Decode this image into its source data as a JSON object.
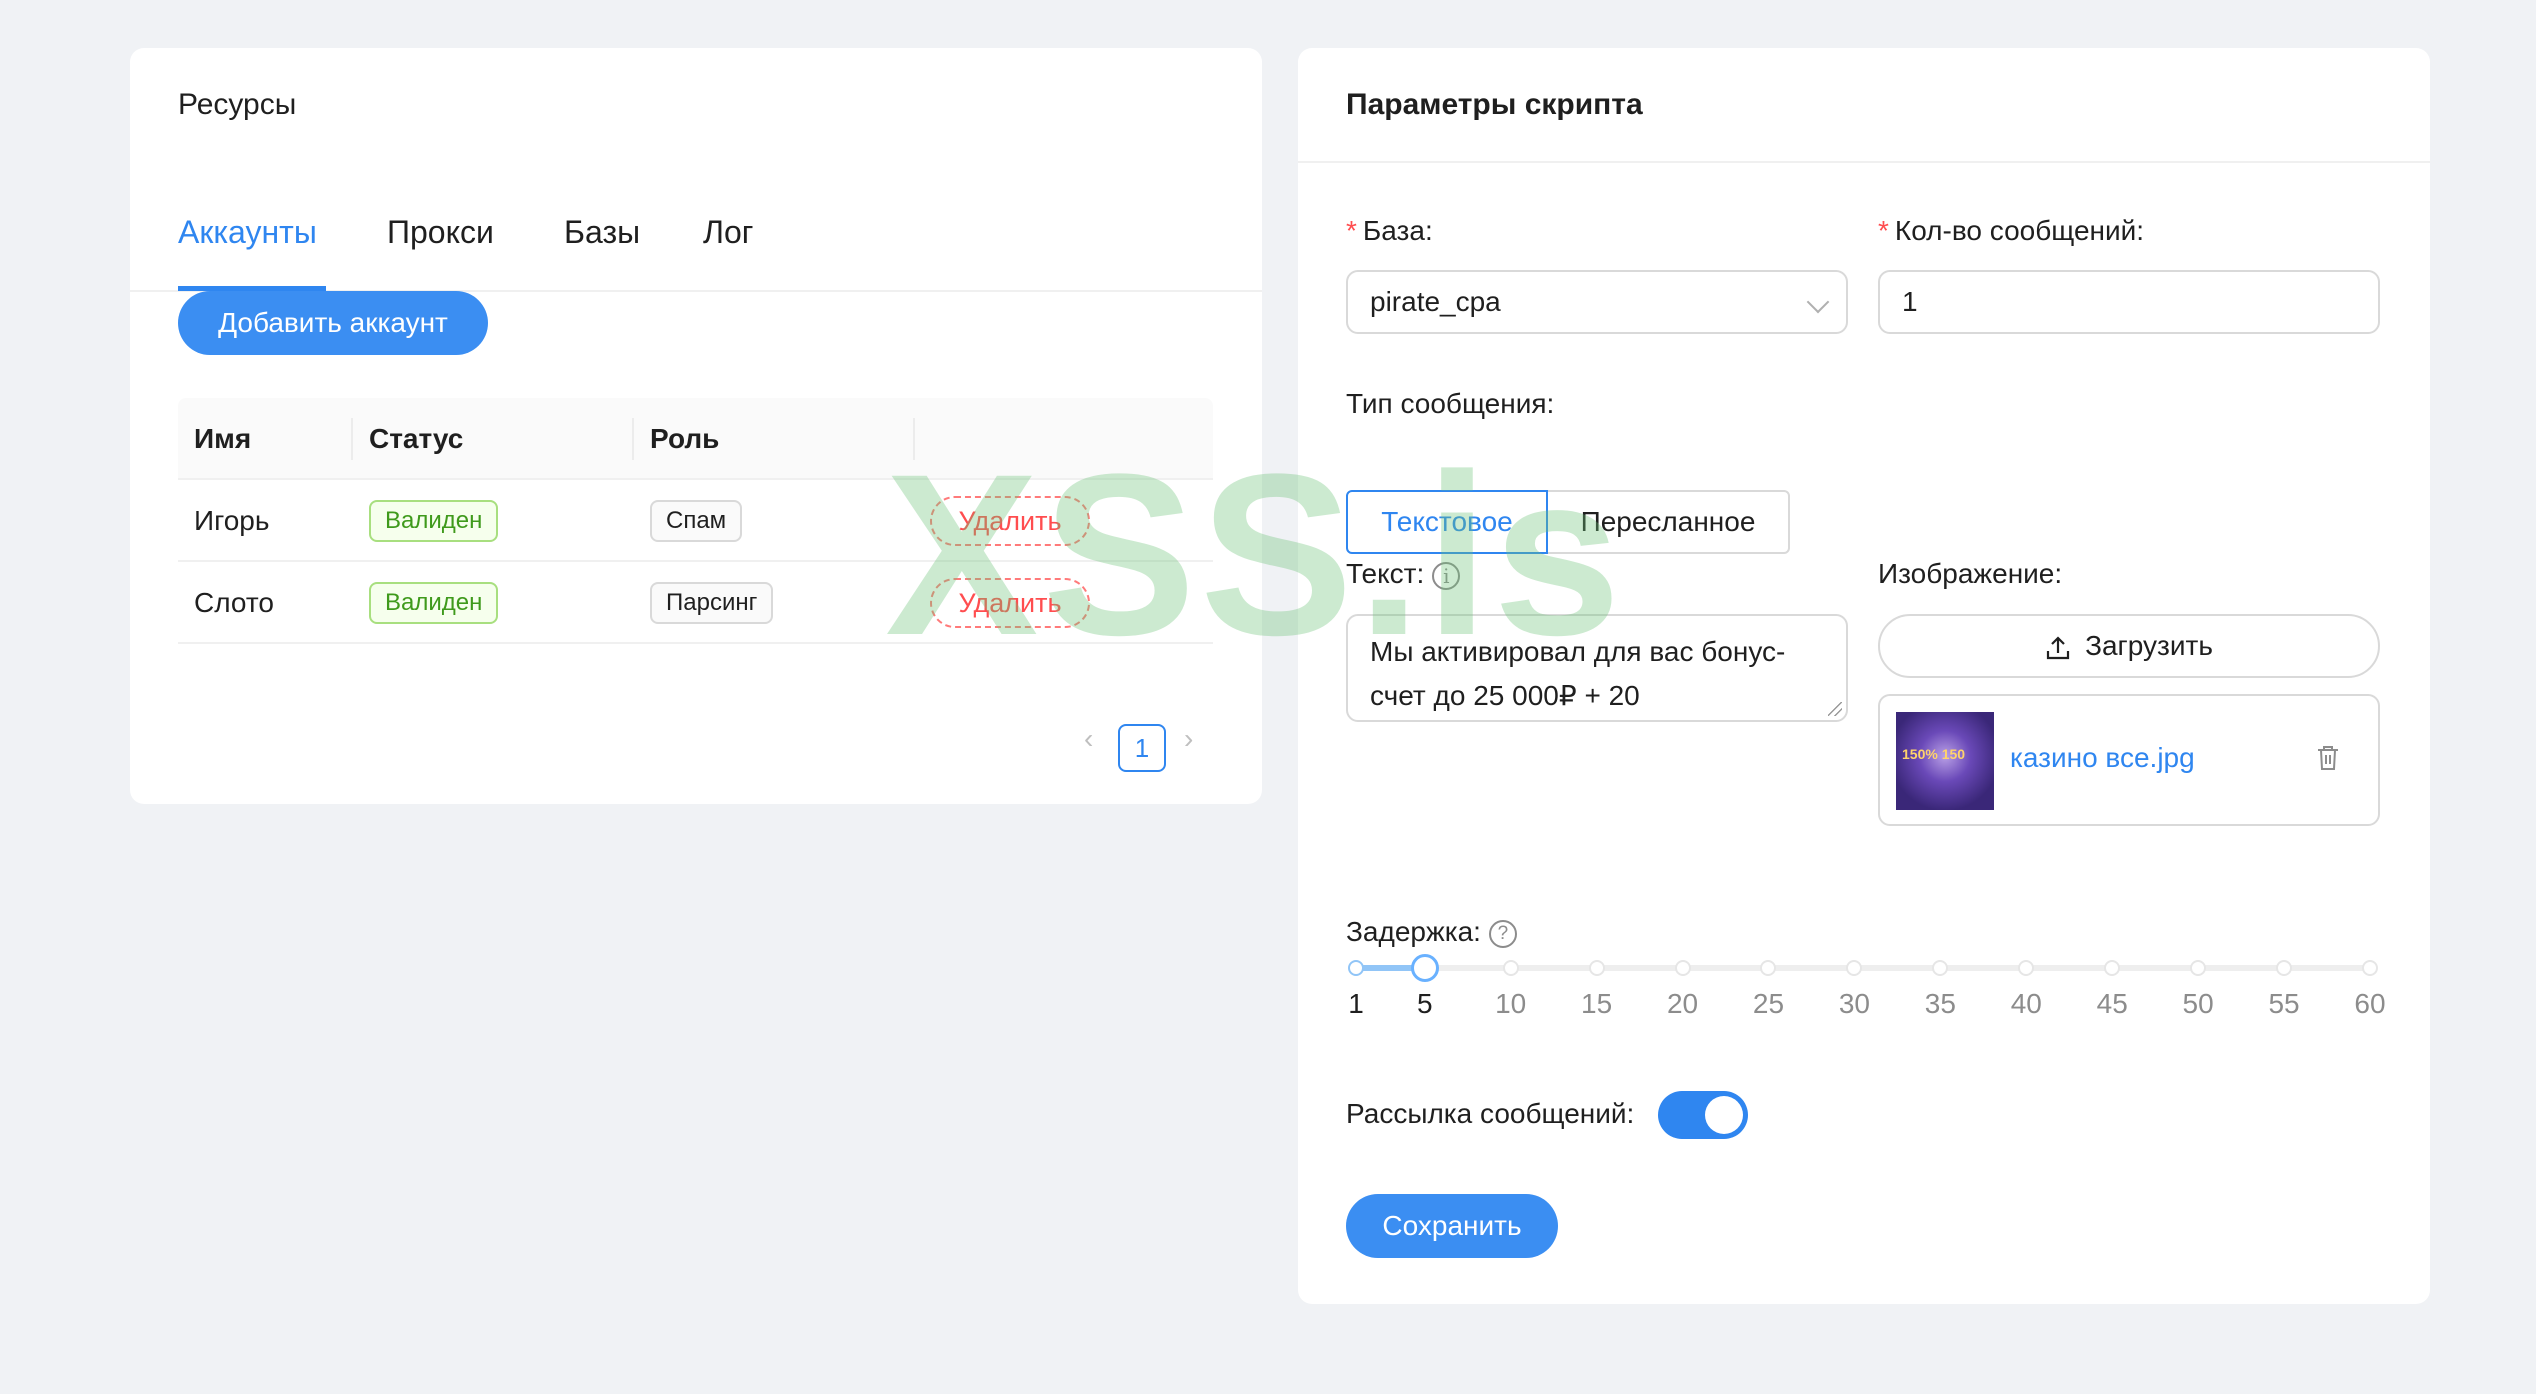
{
  "resources": {
    "title": "Ресурсы",
    "tabs": [
      {
        "label": "Аккаунты",
        "active": true
      },
      {
        "label": "Прокси",
        "active": false
      },
      {
        "label": "Базы",
        "active": false
      },
      {
        "label": "Лог",
        "active": false
      }
    ],
    "add_button": "Добавить аккаунт",
    "table": {
      "columns": [
        "Имя",
        "Статус",
        "Роль"
      ],
      "rows": [
        {
          "name": "Игорь",
          "status": "Валиден",
          "role": "Спам",
          "action": "Удалить"
        },
        {
          "name": "Слото",
          "status": "Валиден",
          "role": "Парсинг",
          "action": "Удалить"
        }
      ]
    },
    "pagination": {
      "current_page": "1",
      "prev_icon": "chevron-left-icon",
      "next_icon": "chevron-right-icon"
    }
  },
  "script_params": {
    "title": "Параметры скрипта",
    "base": {
      "label": "База:",
      "required_mark": "*",
      "value": "pirate_cpa"
    },
    "message_count": {
      "label": "Кол-во сообщений:",
      "required_mark": "*",
      "value": "1"
    },
    "message_type": {
      "label": "Тип сообщения:",
      "options": [
        "Текстовое",
        "Пересланное"
      ],
      "selected": "Текстовое"
    },
    "text": {
      "label": "Текст:",
      "value_line1": "Мы активировал для вас бонус-",
      "value_line2": "счет до 25 000₽ + 20"
    },
    "image": {
      "label": "Изображение:",
      "upload_label": "Загрузить",
      "file_name": "казино все.jpg",
      "thumb_text": "150% 150"
    },
    "delay": {
      "label": "Задержка:",
      "value": 5,
      "marks": [
        "1",
        "5",
        "10",
        "15",
        "20",
        "25",
        "30",
        "35",
        "40",
        "45",
        "50",
        "55",
        "60"
      ]
    },
    "mailing": {
      "label": "Рассылка сообщений:",
      "enabled": true
    },
    "save_button": "Сохранить"
  },
  "watermark": "XSS.is",
  "colors": {
    "accent": "#2f86f0",
    "valid_green": "#3f9a1c",
    "danger": "#ff4d4f",
    "background": "#f0f2f5"
  }
}
